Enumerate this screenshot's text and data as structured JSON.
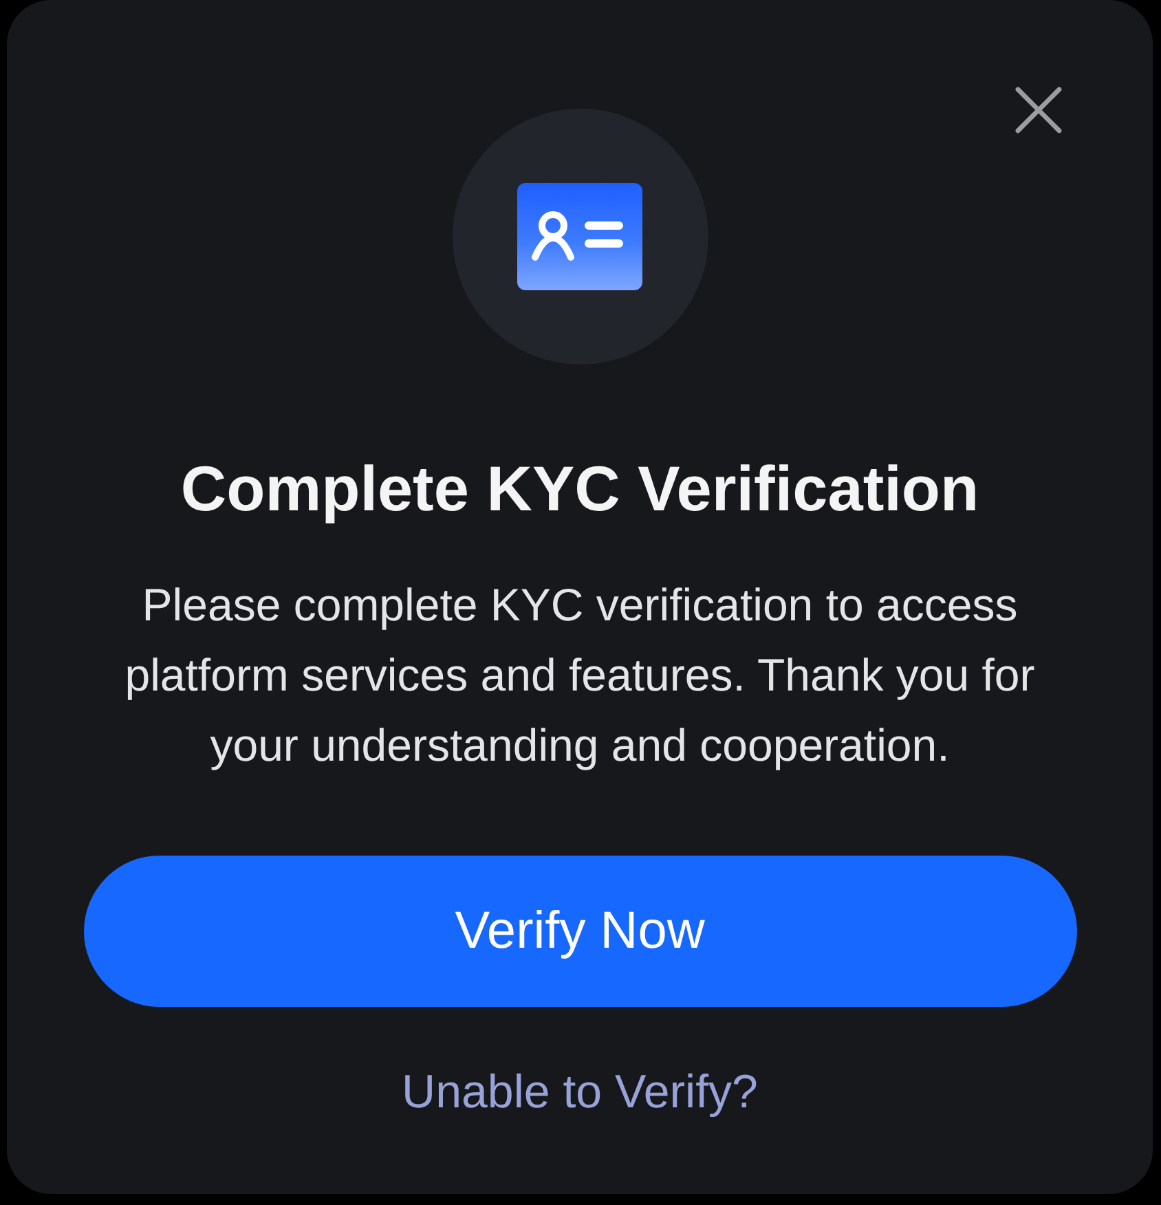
{
  "dialog": {
    "title": "Complete KYC Verification",
    "message": "Please complete KYC verification to access platform services and features. Thank you for your understanding and cooperation.",
    "primary_button": "Verify Now",
    "secondary_link": "Unable to Verify?"
  }
}
